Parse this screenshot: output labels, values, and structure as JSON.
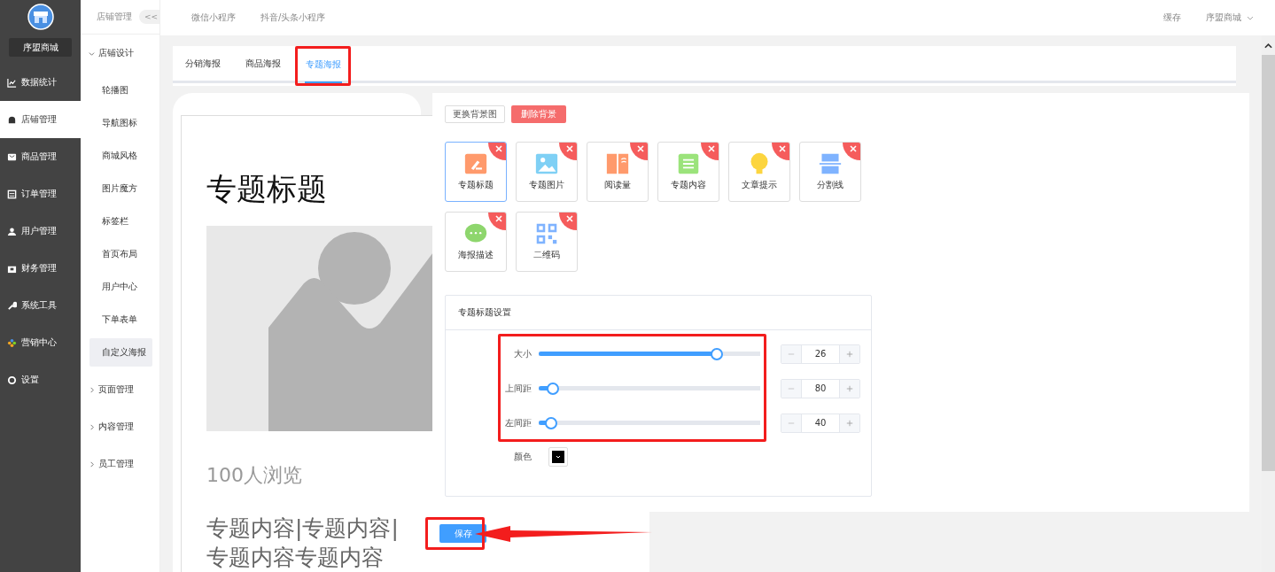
{
  "brand": {
    "name": "序盟商城"
  },
  "main_menu": [
    {
      "label": "数据统计",
      "kind": "chart",
      "selected": false
    },
    {
      "label": "店铺管理",
      "kind": "store",
      "selected": true
    },
    {
      "label": "商品管理",
      "kind": "mail",
      "selected": false
    },
    {
      "label": "订单管理",
      "kind": "list",
      "selected": false
    },
    {
      "label": "用户管理",
      "kind": "user",
      "selected": false
    },
    {
      "label": "财务管理",
      "kind": "wallet",
      "selected": false
    },
    {
      "label": "系统工具",
      "kind": "wrench",
      "selected": false
    },
    {
      "label": "营销中心",
      "kind": "apps",
      "selected": false
    },
    {
      "label": "设置",
      "kind": "gear",
      "selected": false
    }
  ],
  "sub_menu": {
    "title": "店铺管理",
    "collapse": "<<",
    "groups": [
      {
        "label": "店铺设计",
        "expanded": true,
        "children": [
          {
            "label": "轮播图",
            "selected": false
          },
          {
            "label": "导航图标",
            "selected": false
          },
          {
            "label": "商城风格",
            "selected": false
          },
          {
            "label": "图片魔方",
            "selected": false
          },
          {
            "label": "标签栏",
            "selected": false
          },
          {
            "label": "首页布局",
            "selected": false
          },
          {
            "label": "用户中心",
            "selected": false
          },
          {
            "label": "下单表单",
            "selected": false
          },
          {
            "label": "自定义海报",
            "selected": true
          }
        ]
      },
      {
        "label": "页面管理",
        "expanded": false
      },
      {
        "label": "内容管理",
        "expanded": false
      },
      {
        "label": "员工管理",
        "expanded": false
      }
    ]
  },
  "top_tabs": [
    {
      "label": "微信小程序"
    },
    {
      "label": "抖音/头条小程序"
    }
  ],
  "top_right": {
    "cache": "缓存",
    "user": "序盟商城"
  },
  "poster_tabs": [
    {
      "label": "分销海报",
      "selected": false
    },
    {
      "label": "商品海报",
      "selected": false
    },
    {
      "label": "专题海报",
      "selected": true
    }
  ],
  "poster": {
    "title": "专题标题",
    "views": "100人浏览",
    "content": "专题内容|专题内容|专题内容专题内容"
  },
  "bg_buttons": {
    "change": "更换背景图",
    "delete": "删除背景"
  },
  "components": [
    {
      "label": "专题标题",
      "kind": "title",
      "selected": true
    },
    {
      "label": "专题图片",
      "kind": "image",
      "selected": false
    },
    {
      "label": "阅读量",
      "kind": "book",
      "selected": false
    },
    {
      "label": "专题内容",
      "kind": "content",
      "selected": false
    },
    {
      "label": "文章提示",
      "kind": "bulb",
      "selected": false
    },
    {
      "label": "分割线",
      "kind": "divider",
      "selected": false
    },
    {
      "label": "海报描述",
      "kind": "chat",
      "selected": false
    },
    {
      "label": "二维码",
      "kind": "qr",
      "selected": false
    }
  ],
  "settings": {
    "title": "专题标题设置",
    "sliders": [
      {
        "label": "大小",
        "level": 0.78,
        "value": "26"
      },
      {
        "label": "上间距",
        "level": 0.06,
        "value": "80"
      },
      {
        "label": "左间距",
        "level": 0.05,
        "value": "40"
      }
    ],
    "color": {
      "label": "颜色"
    }
  },
  "save": "保存"
}
